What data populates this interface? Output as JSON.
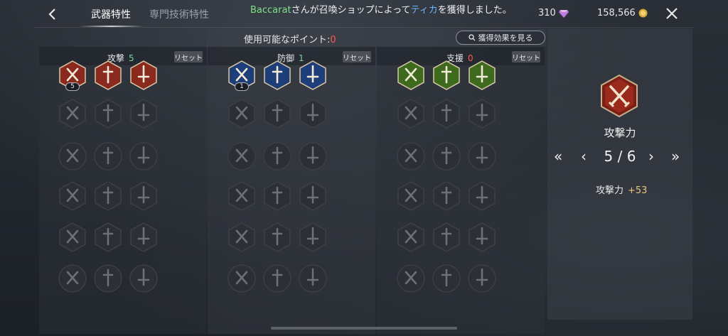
{
  "header": {
    "tabs": [
      {
        "label": "武器特性",
        "active": true
      },
      {
        "label": "専門技術特性",
        "active": false
      }
    ],
    "notice": {
      "name": "Baccarat",
      "middle": "さんが召喚ショップによって",
      "item": "ティカ",
      "end": "を獲得しました。"
    },
    "gems": "310",
    "gold": "158,566"
  },
  "points": {
    "label": "使用可能なポイント",
    "separator": ":",
    "value": "0",
    "effect_button": "獲得効果を見る"
  },
  "columns": [
    {
      "title": "攻撃",
      "points": "5",
      "reset": "リセット"
    },
    {
      "title": "防御",
      "points": "1",
      "reset": "リセット"
    },
    {
      "title": "支援",
      "points": "0",
      "reset": "リセット"
    }
  ],
  "badges": {
    "attack_first": "5",
    "defense_first": "1"
  },
  "detail": {
    "name": "攻撃力",
    "page": "5 / 6",
    "stat_label": "攻撃力",
    "stat_value": "+53"
  },
  "colors": {
    "attack_active": "#8a2a1e",
    "defense_active": "#1e3e7a",
    "support_active": "#3e6a1e",
    "locked": "#2c2f35"
  }
}
